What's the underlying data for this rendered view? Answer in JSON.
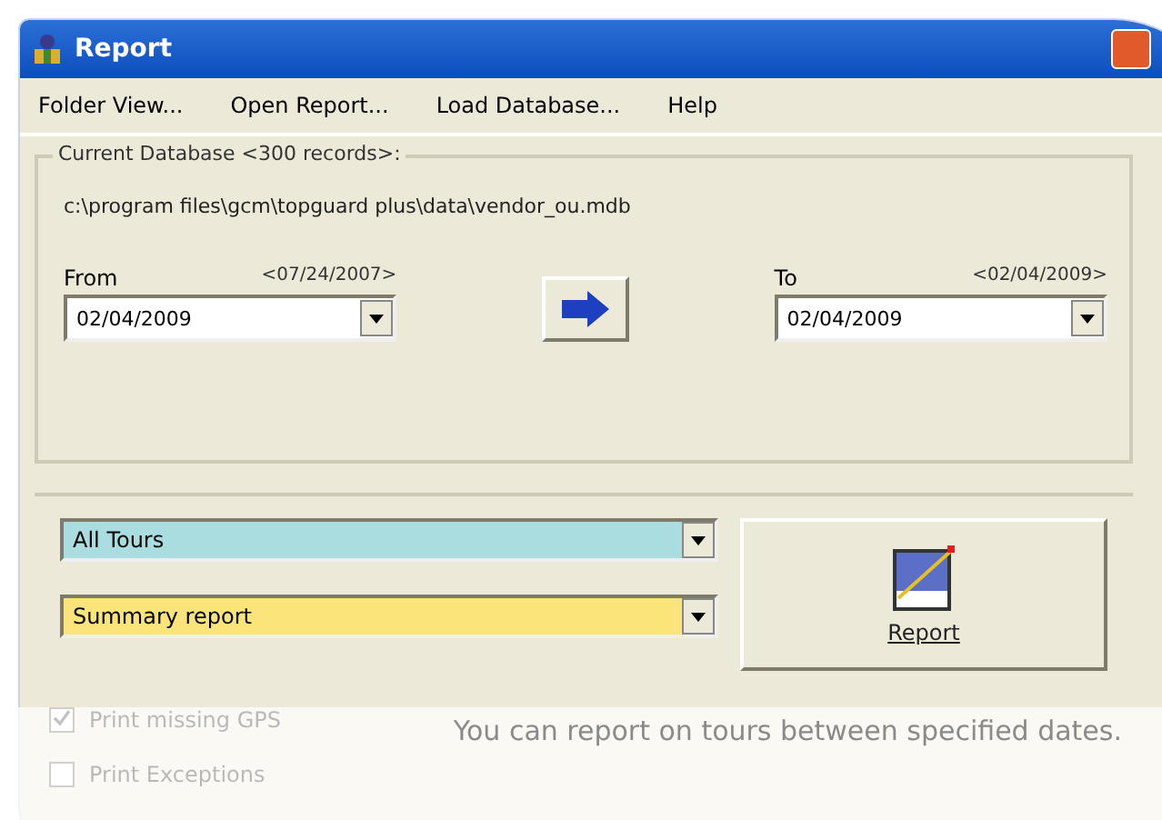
{
  "window": {
    "title": "Report"
  },
  "menu": [
    "Folder View...",
    "Open Report...",
    "Load Database...",
    "Help"
  ],
  "database": {
    "label": "Current Database <300 records>:",
    "path": "c:\\program files\\gcm\\topguard plus\\data\\vendor_ou.mdb"
  },
  "from": {
    "label": "From",
    "range": "<07/24/2007>",
    "value": "02/04/2009"
  },
  "to": {
    "label": "To",
    "range": "<02/04/2009>",
    "value": "02/04/2009"
  },
  "tours": {
    "value": "All Tours",
    "color": "#a9dde0"
  },
  "report_type": {
    "value": "Summary report",
    "color": "#fbe57a"
  },
  "report_button": {
    "label": "Report"
  },
  "options": [
    {
      "label": "Print missing GPS",
      "checked": true
    },
    {
      "label": "Print Exceptions",
      "checked": false
    }
  ],
  "caption": "You can report on tours between specified dates."
}
